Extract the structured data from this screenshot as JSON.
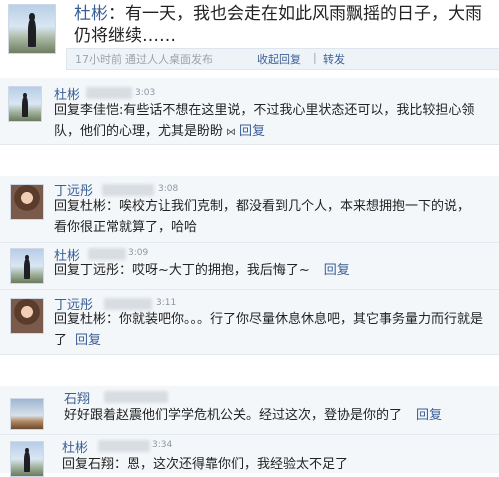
{
  "main_post": {
    "author": "杜彬",
    "text": "有一天，我也会走在如此风雨飘摇的日子，大雨仍将继续……",
    "time": "17小时前",
    "via": "通过人人桌面发布",
    "reply_label": "收起回复",
    "separator": "|",
    "share_label": "转发"
  },
  "comments": [
    {
      "author": "杜彬",
      "time": "3:03",
      "text": "回复李佳恺:有些话不想在这里说，不过我心里状态还可以，我比较担心领队，他们的心理，尤其是盼盼",
      "reply": "回复"
    },
    {
      "author": "丁远彤",
      "time": "3:08",
      "text": "回复杜彬：唉校方让我们克制，都没看到几个人，本来想拥抱一下的说，看你很正常就算了，哈哈",
      "reply": "回复"
    },
    {
      "author": "杜彬",
      "time": "3:09",
      "text": "回复丁远彤：哎呀~大丁的拥抱，我后悔了~",
      "reply": "回复"
    },
    {
      "author": "丁远彤",
      "time": "3:11",
      "text": "回复杜彬：你就装吧你。。。行了你尽量休息休息吧，其它事务量力而行就是了",
      "reply": "回复"
    },
    {
      "author": "石翔",
      "time": "",
      "text": "好好跟着赵震他们学学危机公关。经过这次，登协是你的了",
      "reply": "回复"
    },
    {
      "author": "杜彬",
      "time": "3:34",
      "text": "回复石翔：恩，这次还得靠你们，我经验太不足了",
      "reply": ""
    }
  ],
  "icons": {
    "bow": "bow-icon"
  },
  "colors": {
    "link": "#3a5f96",
    "comment_bg": "#f4f7fa"
  }
}
